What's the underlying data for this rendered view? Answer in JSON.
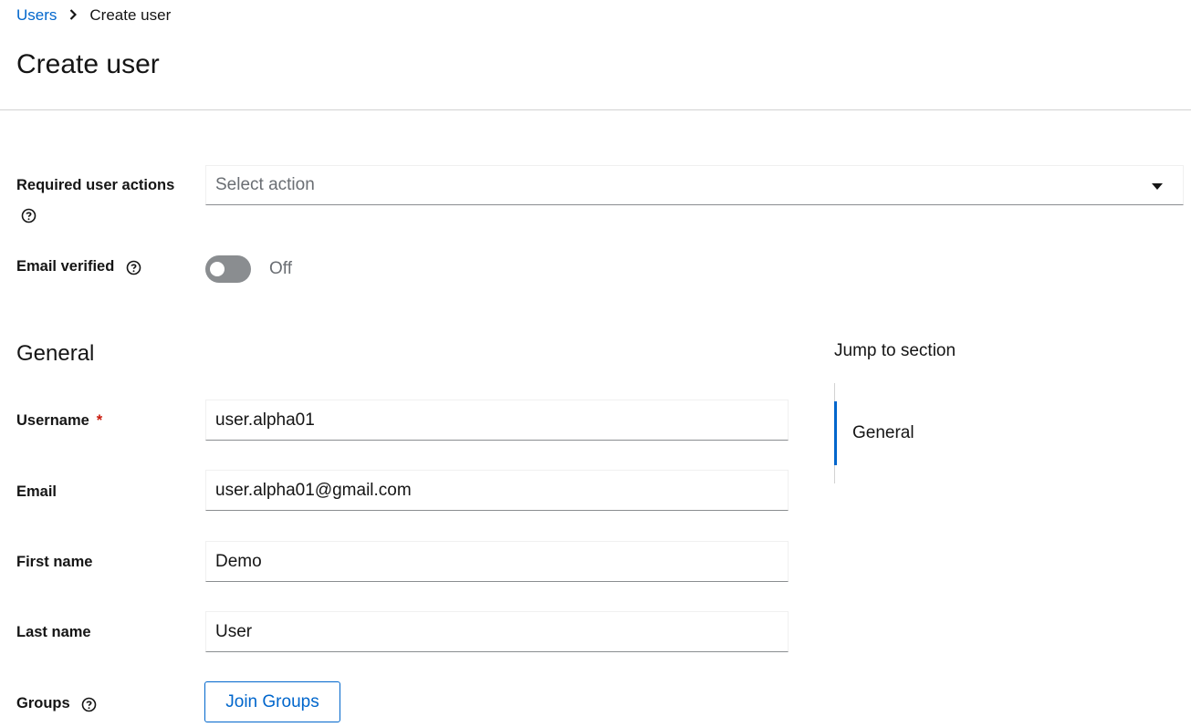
{
  "breadcrumb": {
    "parent": "Users",
    "current": "Create user"
  },
  "page_title": "Create user",
  "form": {
    "required_actions": {
      "label": "Required user actions",
      "placeholder": "Select action"
    },
    "email_verified": {
      "label": "Email verified",
      "state_text": "Off",
      "checked": false
    },
    "general": {
      "title": "General",
      "username": {
        "label": "Username",
        "required_mark": "*",
        "value": "user.alpha01"
      },
      "email": {
        "label": "Email",
        "value": "user.alpha01@gmail.com"
      },
      "first_name": {
        "label": "First name",
        "value": "Demo"
      },
      "last_name": {
        "label": "Last name",
        "value": "User"
      },
      "groups": {
        "label": "Groups",
        "button_label": "Join Groups"
      }
    }
  },
  "jump_to_section": {
    "title": "Jump to section",
    "items": [
      {
        "label": "General",
        "active": true
      }
    ]
  },
  "colors": {
    "link": "#0066cc",
    "required": "#c9190b",
    "toggle_off": "#8a8d90",
    "divider": "#d2d2d2"
  }
}
